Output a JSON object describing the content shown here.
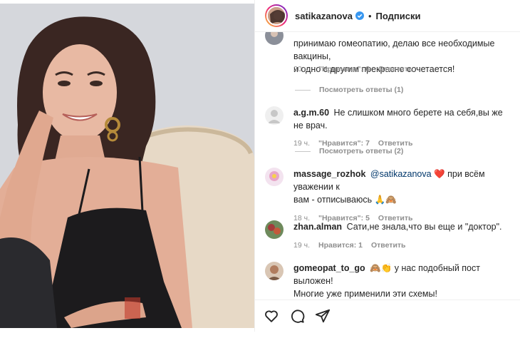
{
  "header": {
    "username": "satikazanova",
    "separator": "•",
    "follow_label": "Подписки"
  },
  "icons": {
    "verified": "verified-badge-icon",
    "like": "heart-icon",
    "comment": "speech-bubble-icon",
    "share": "paper-plane-icon"
  },
  "colors": {
    "verified": "#3897f0",
    "text": "#262626",
    "muted": "#8e8e8e",
    "mention": "#00376b"
  },
  "comments": {
    "c0": {
      "text_line1": "принимаю гомеопатию, делаю все необходимые вакцины,",
      "text_line2": "и одно с другим прекрасно сочетается!",
      "time": "20 ч.",
      "likes": "\"Нравится\": 6",
      "reply": "Ответить",
      "view_replies": "Посмотреть ответы (1)"
    },
    "c1": {
      "user": "a.g.m.60",
      "text": "Не слишком много берете на себя,вы же не врач.",
      "time": "19 ч.",
      "likes": "\"Нравится\": 7",
      "reply": "Ответить",
      "view_replies": "Посмотреть ответы (2)"
    },
    "c2": {
      "user": "massage_rozhok",
      "mention": "@satikazanova",
      "heart": "❤️",
      "text_rest": "при всём уважении к",
      "text_line2": "вам - отписываюсь 🙏🙈",
      "time": "18 ч.",
      "likes": "\"Нравится\": 5",
      "reply": "Ответить"
    },
    "c3": {
      "user": "zhan.alman",
      "text": "Сати,не знала,что вы еще и \"доктор\".",
      "time": "19 ч.",
      "likes": "Нравится: 1",
      "reply": "Ответить"
    },
    "c4": {
      "user": "gomeopat_to_go",
      "text_line1": "🙈👏 у нас подобный пост выложен!",
      "text_line2": "Многие уже применили эти схемы!"
    }
  }
}
